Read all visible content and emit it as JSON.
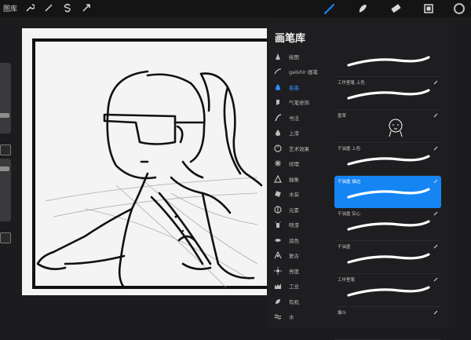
{
  "topbar": {
    "gallery_label": "图库",
    "left_tools": [
      "wrench-icon",
      "magic-wand-icon",
      "selection-s-icon",
      "transform-arrow-icon"
    ],
    "right_tools": [
      "brush-icon",
      "smudge-icon",
      "eraser-icon",
      "layers-icon",
      "color-icon"
    ]
  },
  "library": {
    "title": "画笔库",
    "active_category_index": 2,
    "categories": [
      {
        "label": "绘图",
        "icon": "pencil-tip-icon"
      },
      {
        "label": "galshir 画笔",
        "icon": "stroke-icon"
      },
      {
        "label": "着墨",
        "icon": "ink-drop-icon"
      },
      {
        "label": "气笔修饰",
        "icon": "airbrush-icon"
      },
      {
        "label": "书法",
        "icon": "calligraphy-icon"
      },
      {
        "label": "上漆",
        "icon": "paint-drop-icon"
      },
      {
        "label": "艺术效果",
        "icon": "palette-icon"
      },
      {
        "label": "纹理",
        "icon": "texture-icon"
      },
      {
        "label": "抽象",
        "icon": "triangle-icon"
      },
      {
        "label": "木炭",
        "icon": "charcoal-icon"
      },
      {
        "label": "元素",
        "icon": "element-icon"
      },
      {
        "label": "喷漆",
        "icon": "spray-icon"
      },
      {
        "label": "润色",
        "icon": "touchup-icon"
      },
      {
        "label": "复古",
        "icon": "retro-icon"
      },
      {
        "label": "亮度",
        "icon": "brightness-icon"
      },
      {
        "label": "工业",
        "icon": "industrial-icon"
      },
      {
        "label": "有机",
        "icon": "organic-icon"
      },
      {
        "label": "水",
        "icon": "water-icon"
      }
    ],
    "brushes": [
      {
        "label": "",
        "selected": false,
        "stroke": "smooth"
      },
      {
        "label": "工作室笔 上色",
        "selected": false,
        "stroke": "smooth"
      },
      {
        "label": "墨草",
        "selected": false,
        "stroke": "sketch"
      },
      {
        "label": "干油墨 上色",
        "selected": false,
        "stroke": "smooth"
      },
      {
        "label": "干油墨 描边",
        "selected": true,
        "stroke": "smooth"
      },
      {
        "label": "干油墨 实心",
        "selected": false,
        "stroke": "smooth"
      },
      {
        "label": "干油墨",
        "selected": false,
        "stroke": "smooth"
      },
      {
        "label": "工作室笔",
        "selected": false,
        "stroke": "smooth"
      },
      {
        "label": "烟斗",
        "selected": false,
        "stroke": "none"
      }
    ]
  },
  "colors": {
    "accent": "#1585f4",
    "panel": "#1e1e20",
    "canvas": "#f4f4f4"
  }
}
